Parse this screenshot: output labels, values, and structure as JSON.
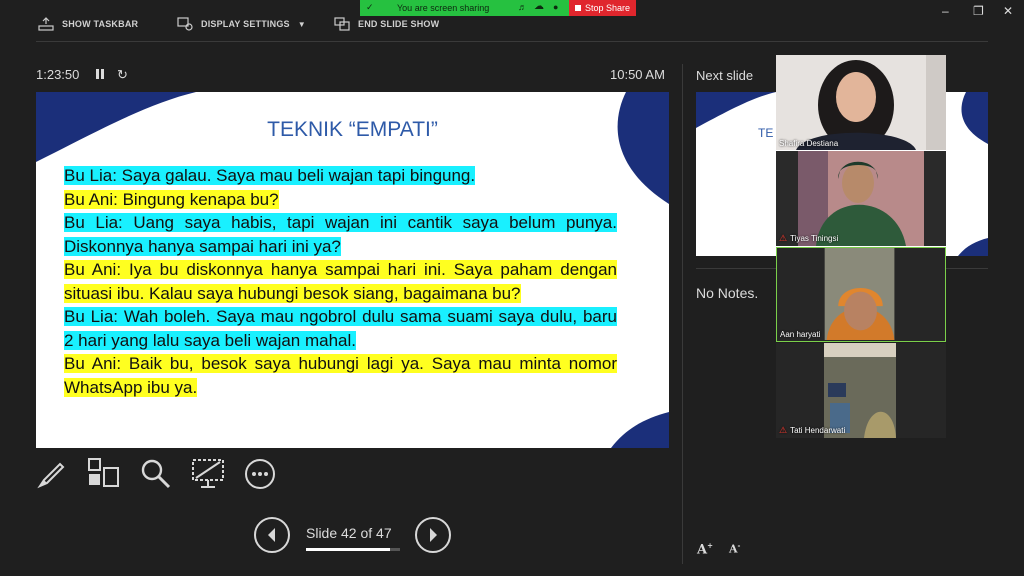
{
  "topbar": {
    "show_taskbar": "SHOW TASKBAR",
    "display_settings": "DISPLAY SETTINGS",
    "end_slide_show": "END SLIDE SHOW"
  },
  "share": {
    "status": "You are screen sharing",
    "stop_label": "Stop Share"
  },
  "presenter": {
    "elapsed": "1:23:50",
    "clock": "10:50 AM",
    "slide_counter": "Slide 42 of 47",
    "progress_fraction": 0.894
  },
  "slide": {
    "title": "TEKNIK “EMPATI”",
    "lines": [
      {
        "text": "Bu Lia: Saya galau. Saya mau beli wajan tapi bingung.",
        "highlight": "cyan"
      },
      {
        "text": "Bu Ani: Bingung kenapa bu?",
        "highlight": "yellow"
      },
      {
        "text": "Bu Lia: Uang saya habis, tapi wajan ini cantik saya belum punya. Diskonnya hanya sampai hari ini ya?",
        "highlight": "cyan"
      },
      {
        "text": "Bu Ani: Iya bu diskonnya hanya sampai hari ini. Saya paham dengan situasi ibu. Kalau saya hubungi besok siang, bagaimana bu?",
        "highlight": "yellow"
      },
      {
        "text": "Bu Lia: Wah boleh. Saya mau ngobrol dulu sama suami saya dulu, baru 2 hari yang lalu saya beli wajan mahal.",
        "highlight": "cyan"
      },
      {
        "text": "Bu Ani: Baik bu, besok saya hubungi lagi ya. Saya mau minta nomor WhatsApp ibu ya.",
        "highlight": "yellow"
      }
    ]
  },
  "right_pane": {
    "next_slide_label": "Next slide",
    "next_thumb_text": "TE",
    "notes": "No Notes."
  },
  "participants": [
    {
      "name": "Shafira Destiana",
      "muted": false
    },
    {
      "name": "Tiyas Tiningsi",
      "muted": true
    },
    {
      "name": "Aan haryati",
      "muted": false
    },
    {
      "name": "Tati Hendarwati",
      "muted": true
    }
  ],
  "colors": {
    "accent_navy": "#1b2f7a",
    "title_blue": "#2e5aa8",
    "highlight_cyan": "#19f0ff",
    "highlight_yellow": "#ffff20",
    "share_green": "#26c140",
    "stop_red": "#e0262d"
  }
}
